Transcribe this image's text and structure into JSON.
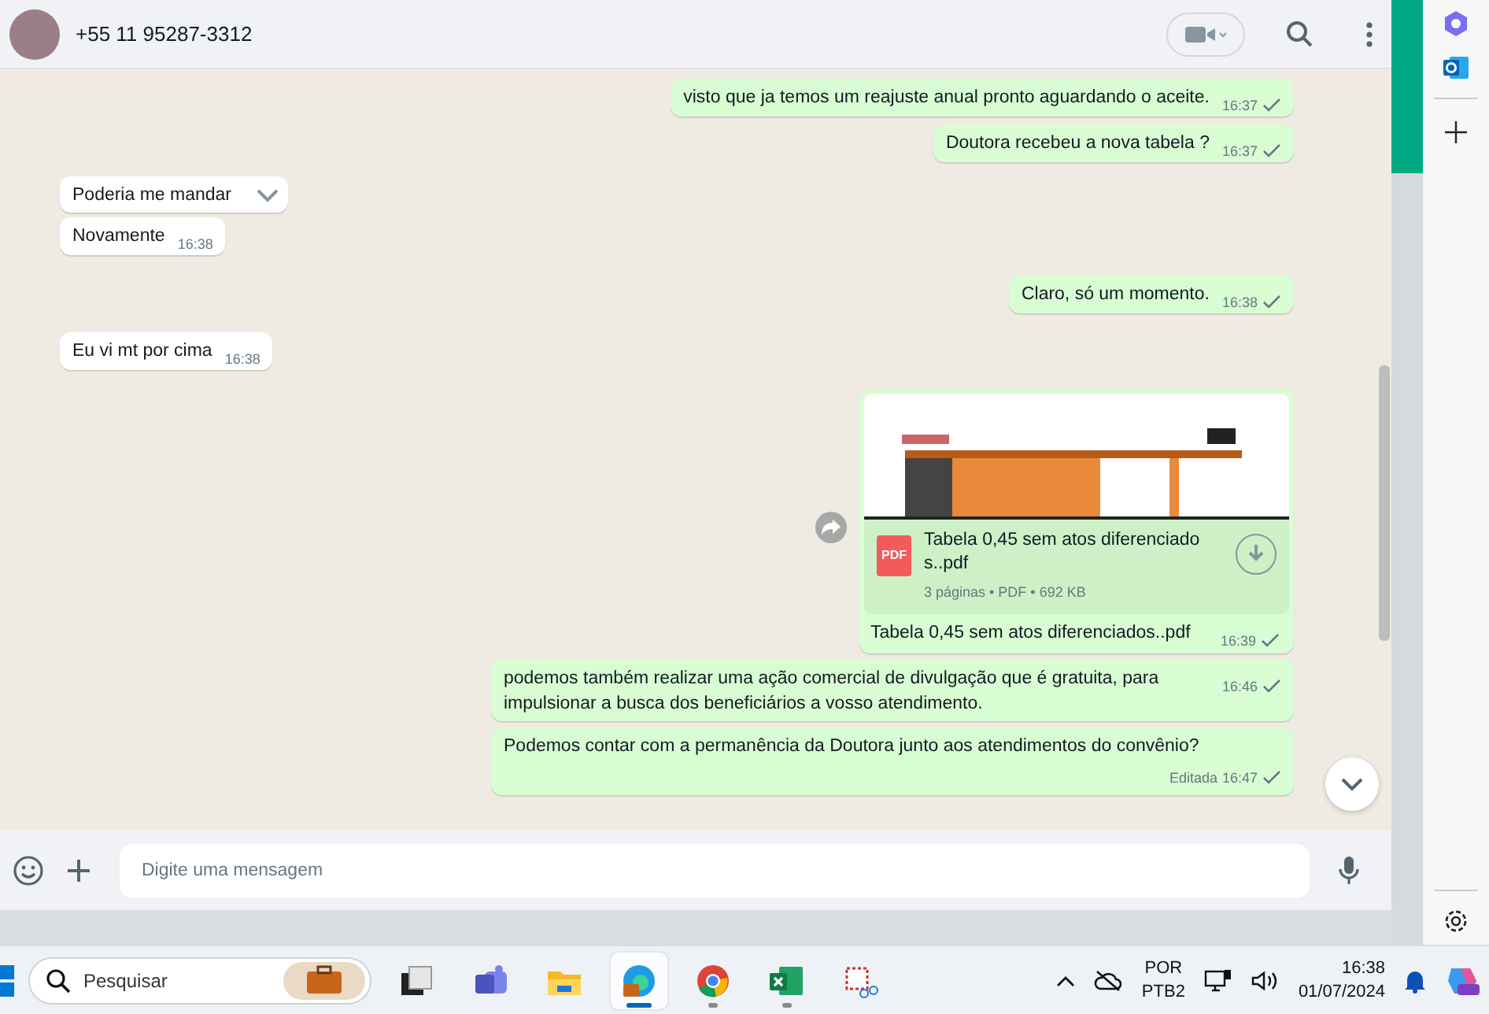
{
  "chat_header": {
    "contact": "+55 11 95287-3312"
  },
  "messages": [
    {
      "kind": "text",
      "outgoing": true,
      "text": "visto que ja temos um reajuste anual pronto aguardando o aceite.",
      "time": "16:37",
      "sent": true
    },
    {
      "kind": "text",
      "outgoing": true,
      "text": "Doutora recebeu a nova tabela ?",
      "time": "16:37",
      "sent": true
    },
    {
      "kind": "text",
      "outgoing": false,
      "text": "Poderia me mandar",
      "menu_open": true
    },
    {
      "kind": "text",
      "outgoing": false,
      "text": "Novamente",
      "time": "16:38"
    },
    {
      "kind": "text",
      "outgoing": true,
      "text": "Claro, só um momento.",
      "time": "16:38",
      "sent": true
    },
    {
      "kind": "text",
      "outgoing": false,
      "text": "Eu vi mt por cima",
      "time": "16:38"
    },
    {
      "kind": "document",
      "outgoing": true,
      "file_name": "Tabela 0,45 sem atos diferenciado s..pdf",
      "file_type": "PDF",
      "details": "3 páginas • PDF • 692 KB",
      "caption": "Tabela 0,45 sem atos diferenciados..pdf",
      "time": "16:39",
      "sent": true
    },
    {
      "kind": "text",
      "outgoing": true,
      "text": "podemos também realizar uma ação comercial de divulgação que é gratuita, para impulsionar a busca dos beneficiários a vosso atendimento.",
      "time": "16:46",
      "sent": true
    },
    {
      "kind": "text",
      "outgoing": true,
      "text": "Podemos contar com a permanência da Doutora junto aos atendimentos do convênio?",
      "edited_label": "Editada",
      "time": "16:47",
      "sent": true
    }
  ],
  "composer": {
    "placeholder": "Digite uma mensagem"
  },
  "taskbar": {
    "search_placeholder": "Pesquisar",
    "apps": [
      {
        "kind": "taskview",
        "selected": false,
        "running": false
      },
      {
        "kind": "teams",
        "selected": false,
        "running": false
      },
      {
        "kind": "explorer",
        "selected": false,
        "running": false
      },
      {
        "kind": "edge",
        "selected": true,
        "running": true
      },
      {
        "kind": "chrome",
        "selected": false,
        "running": true
      },
      {
        "kind": "excel",
        "selected": false,
        "running": true
      },
      {
        "kind": "snip",
        "selected": false,
        "running": false
      }
    ],
    "language": "POR",
    "layout": "PTB2",
    "time": "16:38",
    "date": "01/07/2024"
  }
}
